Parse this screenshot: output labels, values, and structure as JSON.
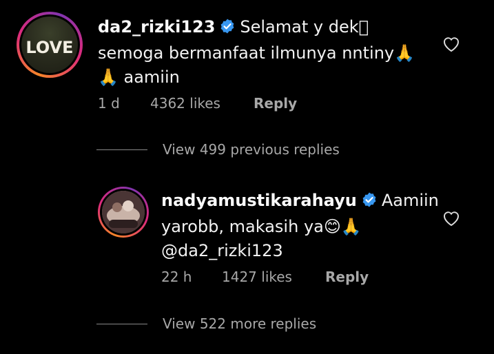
{
  "comment": {
    "username": "da2_rizki123",
    "text_line1": "Selamat y dek\u0000",
    "text_line2": "semoga bermanfaat ilmunya nntiny🙏",
    "text_line3": "🙏 aamiin",
    "time": "1 d",
    "likes": "4362 likes",
    "reply_label": "Reply",
    "avatar_text": "LOVE"
  },
  "view_previous": {
    "label": "View 499 previous replies"
  },
  "reply": {
    "username": "nadyamustikarahayu",
    "text_line1": "Aamiin",
    "text_line2": "yarobb, makasih ya😊🙏",
    "text_line3": "@da2_rizki123",
    "time": "22 h",
    "likes": "1427 likes",
    "reply_label": "Reply"
  },
  "view_more": {
    "label": "View 522 more replies"
  },
  "colors": {
    "background": "#000000",
    "verified": "#3897f0",
    "secondary_text": "#a8a8a8"
  },
  "icons": {
    "verified": "verified-badge-icon",
    "like": "heart-outline-icon"
  }
}
